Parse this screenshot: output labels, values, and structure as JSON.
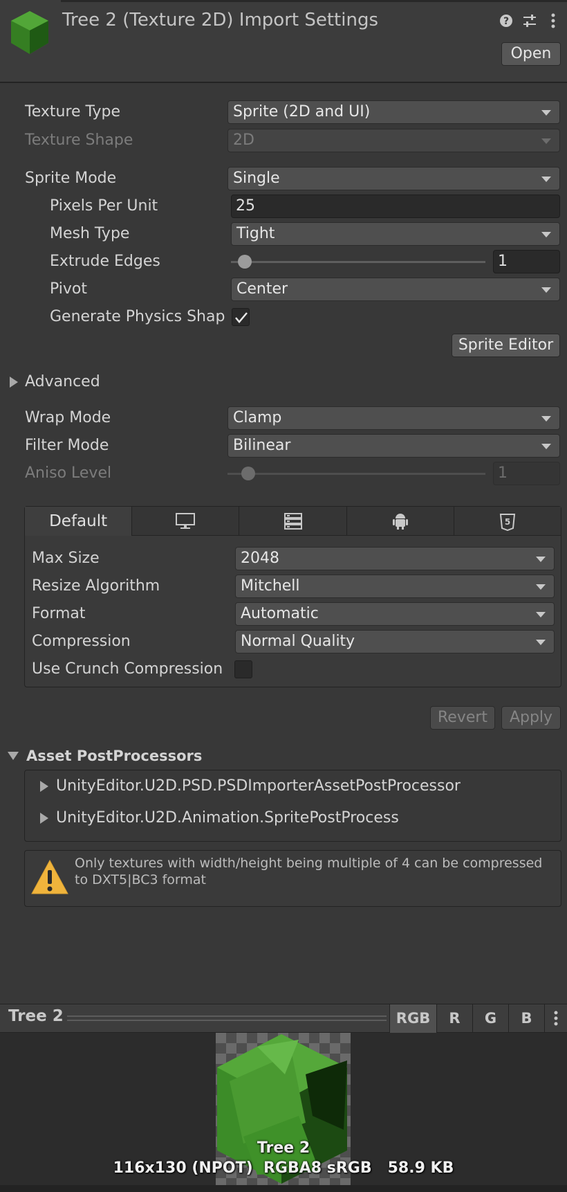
{
  "header": {
    "title": "Tree 2 (Texture 2D) Import Settings",
    "open_label": "Open",
    "icons": [
      "help-icon",
      "settings-sliders-icon",
      "kebab-menu-icon"
    ]
  },
  "settings": {
    "texture_type": {
      "label": "Texture Type",
      "value": "Sprite (2D and UI)"
    },
    "texture_shape": {
      "label": "Texture Shape",
      "value": "2D"
    },
    "sprite_mode": {
      "label": "Sprite Mode",
      "value": "Single"
    },
    "pixels_per_unit": {
      "label": "Pixels Per Unit",
      "value": "25"
    },
    "mesh_type": {
      "label": "Mesh Type",
      "value": "Tight"
    },
    "extrude_edges": {
      "label": "Extrude Edges",
      "value": "1"
    },
    "pivot": {
      "label": "Pivot",
      "value": "Center"
    },
    "generate_physics_shape": {
      "label": "Generate Physics Shap",
      "checked": true
    },
    "sprite_editor_label": "Sprite Editor",
    "advanced_label": "Advanced",
    "wrap_mode": {
      "label": "Wrap Mode",
      "value": "Clamp"
    },
    "filter_mode": {
      "label": "Filter Mode",
      "value": "Bilinear"
    },
    "aniso_level": {
      "label": "Aniso Level",
      "value": "1"
    }
  },
  "platform": {
    "tabs": [
      {
        "label": "Default"
      },
      {
        "icon": "monitor-icon"
      },
      {
        "icon": "server-icon"
      },
      {
        "icon": "android-icon"
      },
      {
        "icon": "html5-icon"
      }
    ],
    "max_size": {
      "label": "Max Size",
      "value": "2048"
    },
    "resize_algorithm": {
      "label": "Resize Algorithm",
      "value": "Mitchell"
    },
    "format": {
      "label": "Format",
      "value": "Automatic"
    },
    "compression": {
      "label": "Compression",
      "value": "Normal Quality"
    },
    "use_crunch": {
      "label": "Use Crunch Compression",
      "checked": false
    }
  },
  "actions": {
    "revert_label": "Revert",
    "apply_label": "Apply"
  },
  "postprocessors": {
    "title": "Asset PostProcessors",
    "items": [
      "UnityEditor.U2D.PSD.PSDImporterAssetPostProcessor",
      "UnityEditor.U2D.Animation.SpritePostProcess"
    ]
  },
  "warning": {
    "icon": "warning-icon",
    "text": "Only textures with width/height being multiple of 4 can be compressed to DXT5|BC3 format"
  },
  "preview": {
    "title": "Tree 2",
    "channels": [
      "RGB",
      "R",
      "G",
      "B"
    ],
    "active_channel": "RGB",
    "name": "Tree 2",
    "info": "116x130 (NPOT)  RGBA8 sRGB   58.9 KB"
  },
  "colors": {
    "background": "#383838",
    "header": "#3c3c3c",
    "dropdown": "#4f4f4f",
    "warning": "#f0b43c",
    "tree_green": "#3f8f2a"
  }
}
